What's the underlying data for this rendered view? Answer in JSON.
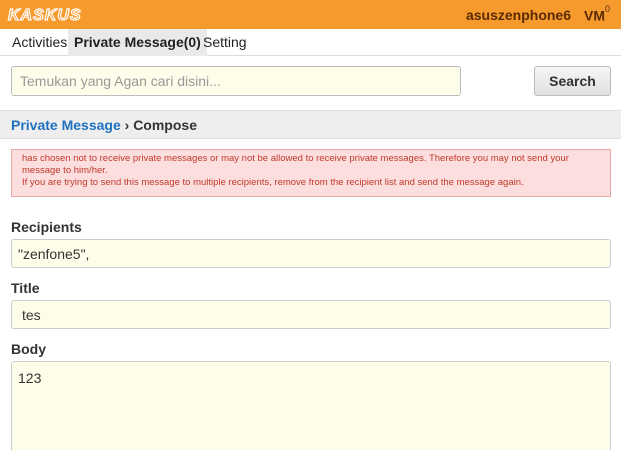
{
  "header": {
    "logo_text": "KASKUS",
    "username": "asuszenphone6",
    "vm_label": "VM",
    "vm_count": "0"
  },
  "tabs": [
    {
      "label": "Activities",
      "active": false
    },
    {
      "label": "Private Message(0)",
      "active": true
    },
    {
      "label": "Setting",
      "active": false
    }
  ],
  "search": {
    "placeholder": "Temukan yang Agan cari disini...",
    "value": "",
    "button_label": "Search"
  },
  "breadcrumb": {
    "link": "Private Message",
    "separator": "›",
    "current": "Compose"
  },
  "error": {
    "line1": "has chosen not to receive private messages or may not be allowed to receive private messages. Therefore you may not send your message to him/her.",
    "line2": "If you are trying to send this message to multiple recipients, remove from the recipient list and send the message again."
  },
  "form": {
    "recipients_label": "Recipients",
    "recipients_value": "\"zenfone5\",",
    "title_label": "Title",
    "title_value": "tes",
    "body_label": "Body",
    "body_value": "123"
  },
  "colors": {
    "header_bg": "#f79a2e",
    "link": "#1f72c0",
    "error_text": "#c0392b",
    "error_bg": "#fcdede",
    "field_bg": "#fdfde9"
  }
}
